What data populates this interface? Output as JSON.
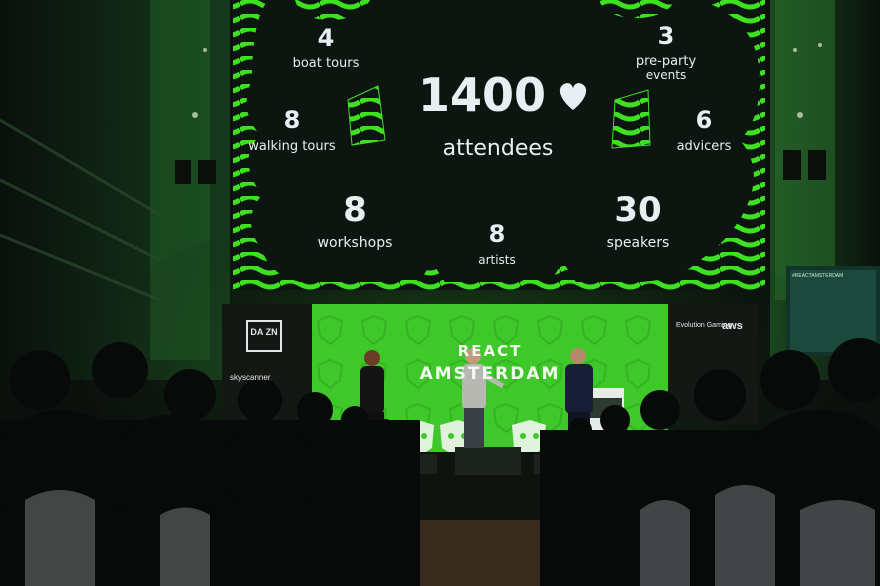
{
  "screen": {
    "stats": [
      {
        "id": "boat-tours",
        "value": "4",
        "label": "boat tours"
      },
      {
        "id": "pre-party",
        "value": "3",
        "label_line1": "pre-party",
        "label_line2": "events"
      },
      {
        "id": "walking-tours",
        "value": "8",
        "label": "walking tours"
      },
      {
        "id": "advicers",
        "value": "6",
        "label": "advicers"
      },
      {
        "id": "workshops",
        "value": "8",
        "label": "workshops"
      },
      {
        "id": "artists",
        "value": "8",
        "label": "artists"
      },
      {
        "id": "speakers",
        "value": "30",
        "label": "speakers"
      }
    ],
    "headline": {
      "value": "1400",
      "label": "attendees",
      "icon": "heart-icon"
    }
  },
  "banner": {
    "line1": "REACT",
    "line2": "AMSTERDAM"
  },
  "sponsors": {
    "dazn": "DA ZN",
    "skyscanner": "skyscanner",
    "evolution": "Evolution Gaming",
    "aws": "aws"
  },
  "side_screen": {
    "hashtag": "#REACTAMSTERDAM"
  },
  "colors": {
    "accent": "#39d421",
    "screen_bg": "#0d1510",
    "banner": "#3fc829"
  }
}
